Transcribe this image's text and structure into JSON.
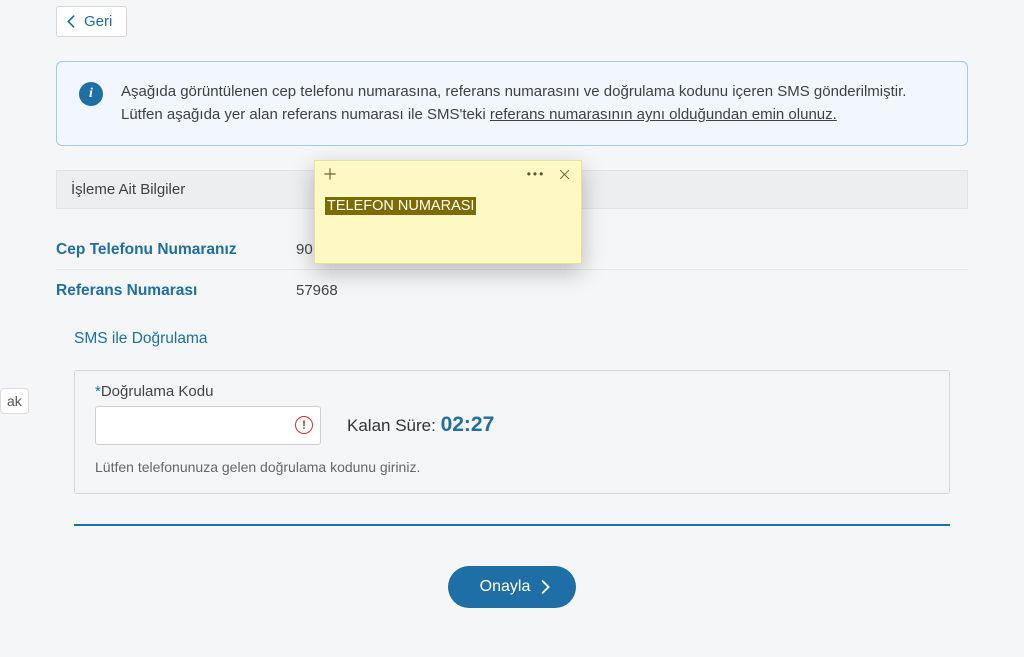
{
  "sidebar_fragment": "ak",
  "back_button": "Geri",
  "alert": {
    "line1": "Aşağıda görüntülenen cep telefonu numarasına, referans numarasını ve doğrulama kodunu içeren SMS gönderilmiştir.",
    "line2_prefix": "Lütfen aşağıda yer alan referans numarası ile SMS'teki ",
    "line2_underlined": "referans numarasının aynı olduğundan emin olunuz."
  },
  "section_header": "İşleme Ait Bilgiler",
  "fields": {
    "phone_label": "Cep Telefonu Numaranız",
    "phone_value": "90",
    "ref_label": "Referans Numarası",
    "ref_value": "57968"
  },
  "sub_title": "SMS ile Doğrulama",
  "code_field": {
    "label_req": "*",
    "label": "Doğrulama Kodu",
    "timer_label": "Kalan Süre: ",
    "timer_value": "02:27",
    "hint": "Lütfen telefonunuza gelen doğrulama kodunu giriniz."
  },
  "submit": "Onayla",
  "sticky_note": {
    "highlight": "TELEFON NUMARASI"
  }
}
